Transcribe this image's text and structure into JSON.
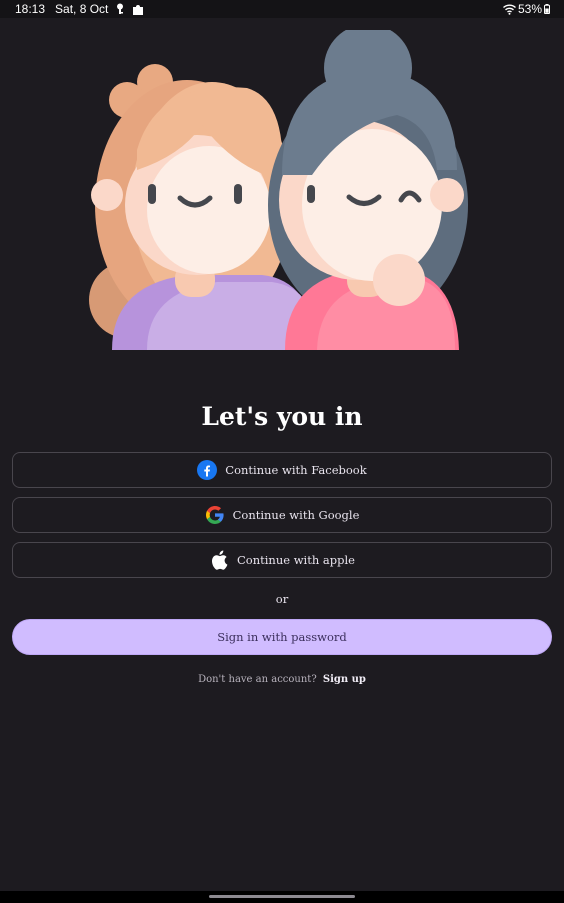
{
  "status_bar": {
    "time": "18:13",
    "date": "Sat, 8 Oct",
    "battery": "53%",
    "icons": [
      "key-icon",
      "puzzle-icon",
      "wifi-icon",
      "battery-icon"
    ]
  },
  "hero": {
    "illustration": "two-friends-avatars",
    "colors": {
      "hair_left": "#f0b894",
      "shirt_left": "#c9aee6",
      "hair_right": "#6c7c8e",
      "shirt_right": "#ff8da4",
      "skin": "#fdeee6"
    }
  },
  "auth": {
    "title": "Let's you in",
    "facebook_label": "Continue with Facebook",
    "google_label": "Continue with Google",
    "apple_label": "Continue with apple",
    "divider": "or",
    "password_label": "Sign in with password",
    "signup_prompt": "Don't have an account?",
    "signup_link": "Sign up"
  },
  "colors": {
    "background": "#1d1b20",
    "primary": "#d0bcff",
    "facebook": "#1877f2"
  }
}
